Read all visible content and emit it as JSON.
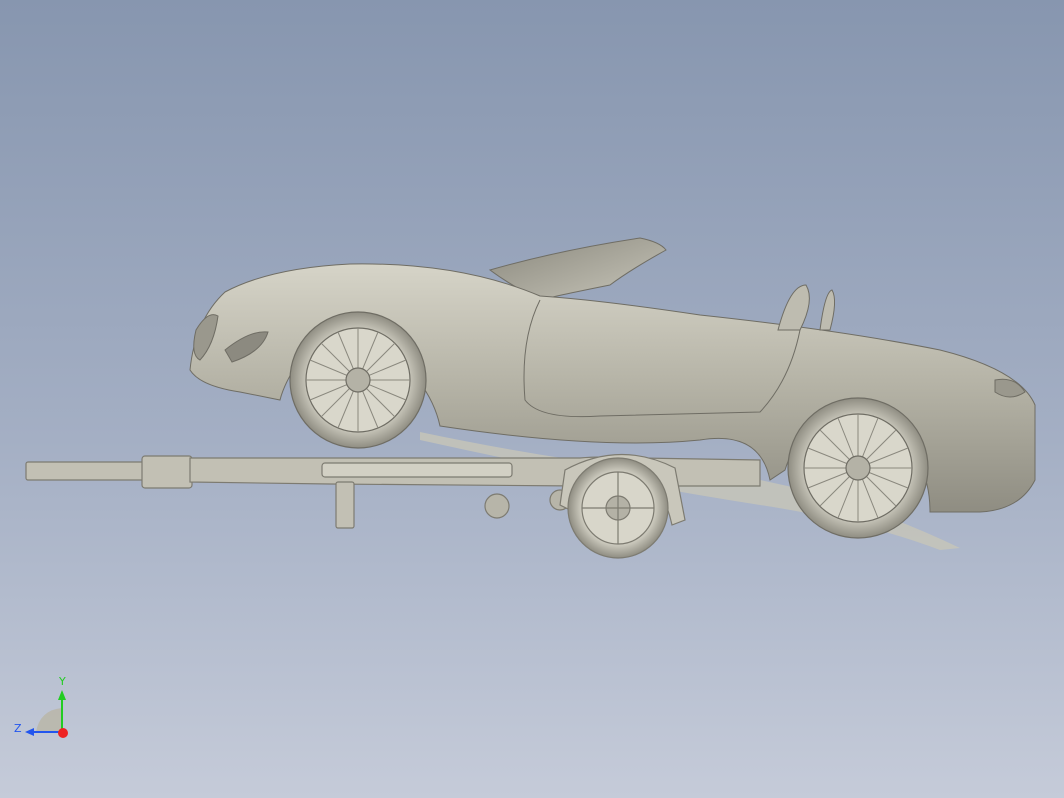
{
  "viewport": {
    "background_top": "#8796af",
    "background_bottom": "#c5cbd9",
    "model_color": "#b8b6a8"
  },
  "scene": {
    "model_description": "shaded 3D model"
  },
  "triad": {
    "y_label": "Y",
    "z_label": "Z",
    "y_color": "#22cc22",
    "z_color": "#2255ee",
    "x_color": "#ee2222"
  }
}
